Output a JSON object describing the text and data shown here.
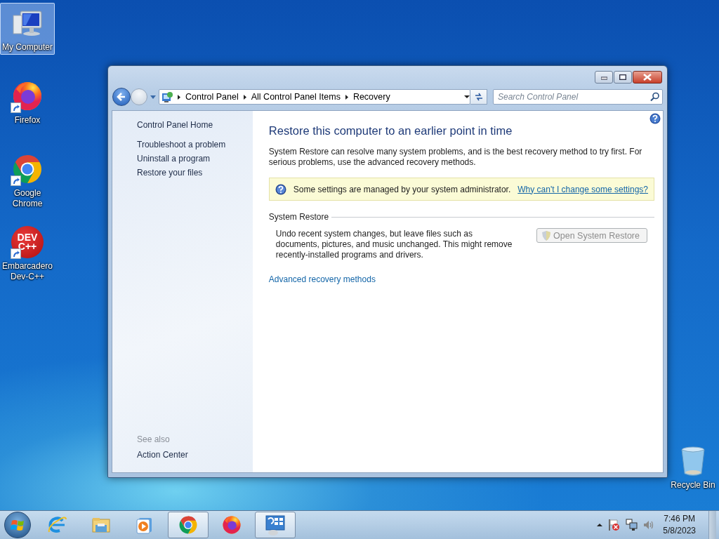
{
  "desktop_icons": [
    {
      "label": "My Computer",
      "kind": "computer",
      "selected": true,
      "shortcut": false
    },
    {
      "label": "Firefox",
      "kind": "firefox",
      "selected": false,
      "shortcut": true
    },
    {
      "label": "Google Chrome",
      "kind": "chrome",
      "selected": false,
      "shortcut": true
    },
    {
      "label": "Embarcadero Dev-C++",
      "kind": "devcpp",
      "selected": false,
      "shortcut": true,
      "logo_text": [
        "DEV",
        "C++"
      ]
    },
    {
      "label": "Recycle Bin",
      "kind": "recycle",
      "selected": false,
      "shortcut": false
    }
  ],
  "window": {
    "breadcrumb": [
      "Control Panel",
      "All Control Panel Items",
      "Recovery"
    ],
    "search": {
      "placeholder": "Search Control Panel"
    },
    "sidebar": {
      "home": "Control Panel Home",
      "tasks": [
        "Troubleshoot a problem",
        "Uninstall a program",
        "Restore your files"
      ],
      "see_also_heading": "See also",
      "see_also": [
        "Action Center"
      ]
    },
    "content": {
      "heading": "Restore this computer to an earlier point in time",
      "intro": "System Restore can resolve many system problems, and is the best recovery method to try first. For serious problems, use the advanced recovery methods.",
      "notice": {
        "text": "Some settings are managed by your system administrator.",
        "link": "Why can't I change some settings?"
      },
      "section": {
        "title": "System Restore",
        "description": "Undo recent system changes, but leave files such as documents, pictures, and music unchanged. This might remove recently-installed programs and drivers.",
        "button": {
          "label": "Open System Restore",
          "disabled": true
        }
      },
      "link": "Advanced recovery methods"
    }
  },
  "taskbar": {
    "apps": [
      {
        "kind": "ie",
        "running": false
      },
      {
        "kind": "explorer",
        "running": false
      },
      {
        "kind": "media",
        "running": false
      },
      {
        "kind": "chrome",
        "running": true
      },
      {
        "kind": "firefox",
        "running": false
      },
      {
        "kind": "controlpanel",
        "running": true
      }
    ],
    "clock": {
      "time": "7:46 PM",
      "date": "5/8/2023"
    }
  }
}
